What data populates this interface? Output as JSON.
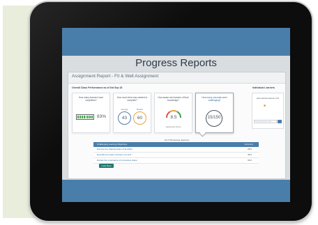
{
  "header": {
    "title": "Progress Reports"
  },
  "assignment": {
    "title": "Assignment Report - Fit & Well Assignment",
    "performance_label": "Overall Class Performance as of 3rd Sep 18",
    "individual_label": "Individual Learners"
  },
  "stats": [
    {
      "question": "How many learners have completed?",
      "value": "83%"
    },
    {
      "question": "How much time was needed to complete?",
      "value_a": "43",
      "value_b": "60",
      "label_a": "Average",
      "label_b": "Median"
    },
    {
      "question": "How aware are learners of their knowledge?",
      "value": "8.5",
      "caption": "Awareness Score"
    },
    {
      "question": "How many concepts were challenging?",
      "value": "15/150"
    }
  ],
  "side_card": {
    "question": "How did this learner do?",
    "emoji": "☻",
    "search_placeholder": "Search by learner name"
  },
  "table": {
    "caption": "15 of 150 learning objectives",
    "header_objective": "Challenging Learning Objectives",
    "header_accuracy": "Accuracy",
    "rows": [
      {
        "objective": "Discuss the characteristics of flexibility",
        "accuracy": "28%"
      },
      {
        "objective": "Describe the basic structure of a joint",
        "accuracy": "38%"
      },
      {
        "objective": "Explain the importance of connective tissue",
        "accuracy": "39%"
      }
    ],
    "button_label": "Load More"
  },
  "colors": {
    "brand_blue": "#4a7eaa",
    "success_green": "#44a04b",
    "warning_orange": "#e8a33a",
    "button_teal": "#1f7a6e"
  },
  "icons": {
    "battery": "battery-icon",
    "gauge": "gauge-icon",
    "emoji": "emoji-icon",
    "search": "search-icon"
  }
}
